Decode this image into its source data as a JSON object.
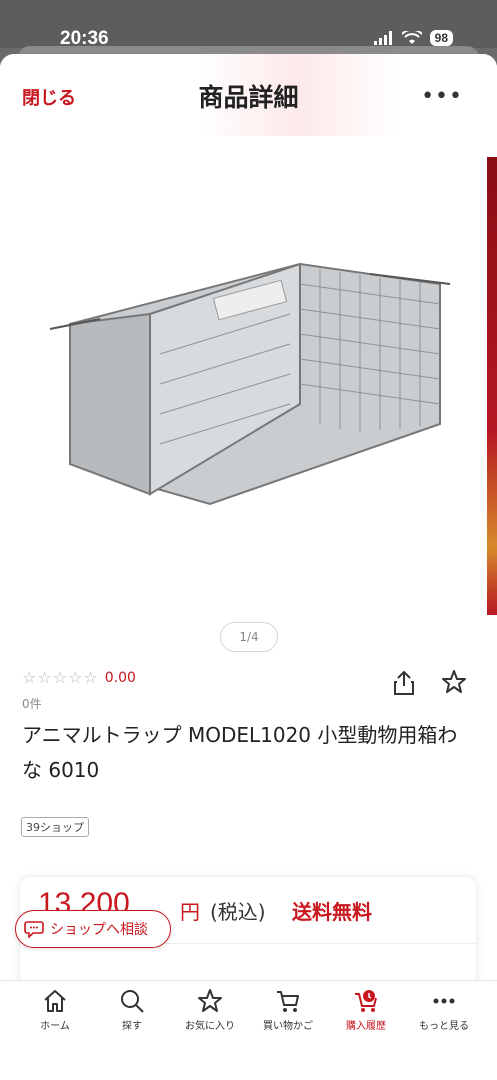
{
  "status": {
    "time": "20:36",
    "battery": "98"
  },
  "header": {
    "close_label": "閉じる",
    "title": "商品詳細",
    "more_icon": "more-horizontal-icon"
  },
  "product": {
    "pager": "1/4",
    "rating_stars": "☆☆☆☆☆",
    "rating_value": "0.00",
    "review_count": "0件",
    "title": "アニマルトラップ MODEL1020 小型動物用箱わな 6010",
    "shop_badge": "39ショップ",
    "price": "13,200",
    "price_yen": "円",
    "price_tax": "(税込)",
    "shipping": "送料無料"
  },
  "consult": {
    "label": "ショップへ相談",
    "icon": "chat-bubble-icon"
  },
  "tabs": [
    {
      "label": "ホーム",
      "icon": "home-icon"
    },
    {
      "label": "探す",
      "icon": "search-icon"
    },
    {
      "label": "お気に入り",
      "icon": "star-icon"
    },
    {
      "label": "買い物かご",
      "icon": "cart-icon"
    },
    {
      "label": "購入履歴",
      "icon": "purchase-history-icon",
      "active": true
    },
    {
      "label": "もっと見る",
      "icon": "more-horizontal-icon"
    }
  ],
  "colors": {
    "accent": "#c8171e",
    "text": "#222222",
    "muted": "#888888"
  }
}
